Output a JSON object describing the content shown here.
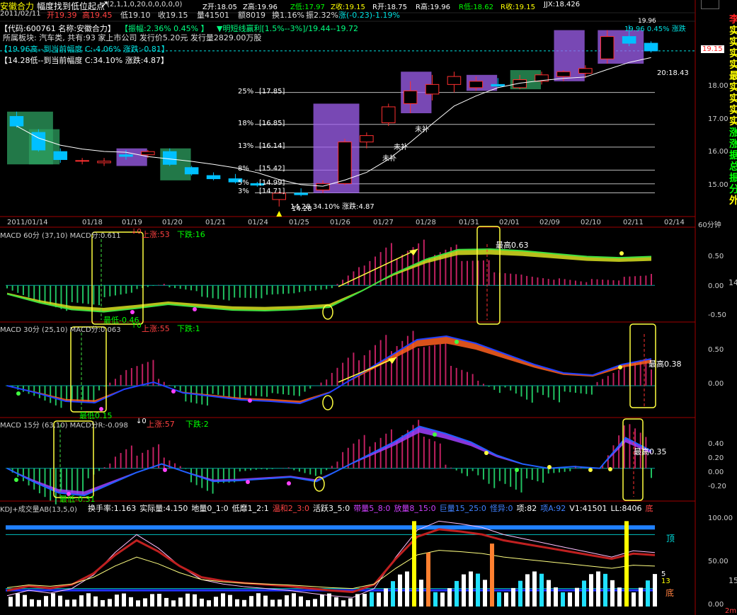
{
  "header": {
    "name": "安徽合力",
    "indicator": "幅度找到低位起点",
    "params": "(2,1,1,0,20,0,0,0,0,0)",
    "z_open": "Z开:18.05",
    "z_high": "Z高:19.96",
    "z_low": "Z低:17.97",
    "z_close": "Z收:19.15",
    "r_open": "R开:18.75",
    "r_high": "R高:19.96",
    "r_low": "R低:18.62",
    "r_close": "R收:19.15",
    "jjx": "JJX:18.426"
  },
  "quote_line": {
    "date": "2011/02/11",
    "open": "开19.39",
    "high": "高19.45",
    "low": "低19.10",
    "close": "收19.15",
    "volume": "量41501",
    "amount": "额8019",
    "turnover": "换1.16%",
    "amplitude": "振2.32%",
    "change": "涨(-0.23)-1.19%"
  },
  "info_lines": {
    "code_line": "【代码:600761 名称:安徽合力】",
    "amp_line": "【振幅:2.36% 0.45% 】",
    "profit_line": "▼明短线赢利[1.5%--3%]/19.44--19.72",
    "sector_line": "所属板块: 汽车类, 共有:93 家上市公司  发行价5.20元  发行量2829.00万股",
    "high_line": "【19.96高--到当前幅度 C:-4.06% 涨跌:-0.81】",
    "low_line": "【14.28低--到当前幅度 C:34.10% 涨跌:4.87】"
  },
  "main_chart": {
    "yticks": [
      "18.00",
      "17.00",
      "16.00",
      "15.00"
    ],
    "price_tag": "19.15",
    "ma_label": "20:18.43",
    "high_tag": "19.96",
    "low_tag": "14.28",
    "low_note": "14.28  34.10%  涨跌:4.87",
    "bu_labels": [
      "未补",
      "未补",
      "未补"
    ],
    "levels": [
      {
        "pct": "25%",
        "price": "[17.85]"
      },
      {
        "pct": "18%",
        "price": "[16.85]"
      },
      {
        "pct": "13%",
        "price": "[16.14]"
      },
      {
        "pct": "8%",
        "price": "[15.42]"
      },
      {
        "pct": "5%",
        "price": "[14.99]"
      },
      {
        "pct": "3%",
        "price": "[14.71]"
      }
    ],
    "top_right_note": "19.96  0.45%  涨跌"
  },
  "date_axis": {
    "dates": [
      "2011/01/14",
      "01/18",
      "01/19",
      "01/20",
      "01/21",
      "01/24",
      "01/25",
      "01/26",
      "01/27",
      "01/28",
      "01/31",
      "02/01",
      "02/09",
      "02/10",
      "02/11",
      "02/14"
    ],
    "period": "60分钟"
  },
  "macd60": {
    "title": "MACD 60分 (37,10)  MACD分:0.611",
    "up": "上涨:53",
    "down": "下跌:16",
    "yticks": [
      "0.50",
      "0.00",
      "-0.50"
    ],
    "low_note": "最低-0.46",
    "high_note": "最高0.63"
  },
  "macd30": {
    "title": "MACD 30分 (25,10)  MACD分:0.063",
    "up": "上涨:55",
    "down": "下跌:1",
    "yticks": [
      "0.50",
      "0.00"
    ],
    "low_note": "最低0.15",
    "high_note": "最高0.38"
  },
  "macd15": {
    "title": "MACD 15分 (63,10)  MACD分R:-0.098",
    "up": "上涨:57",
    "down": "下跌:2",
    "yticks": [
      "0.40",
      "0.20",
      "0.00",
      "-0.20"
    ],
    "low_note": "最低-0.31",
    "high_note": "最高0.35"
  },
  "kdj": {
    "title": "KDJ+成交量AB(13,5,0)",
    "items": [
      {
        "text": "换手率:1.163",
        "color": "#ffffff"
      },
      {
        "text": "实际量:4.150",
        "color": "#ffffff"
      },
      {
        "text": "地量0_1:0",
        "color": "#ffffff"
      },
      {
        "text": "低靡1_2:1",
        "color": "#ffffff"
      },
      {
        "text": "温和2_3:0",
        "color": "#ff4444"
      },
      {
        "text": "活跃3_5:0",
        "color": "#ffffff"
      },
      {
        "text": "带量5_8:0",
        "color": "#d040ff"
      },
      {
        "text": "放量8_15:0",
        "color": "#d040ff"
      },
      {
        "text": "巨量15_25:0",
        "color": "#4080ff"
      },
      {
        "text": "怪异:0",
        "color": "#4080ff"
      },
      {
        "text": "项:82",
        "color": "#ffffff"
      },
      {
        "text": "项A:92",
        "color": "#4080ff"
      },
      {
        "text": "V1:41501",
        "color": "#ffffff"
      },
      {
        "text": "LL:8406",
        "color": "#ffffff"
      },
      {
        "text": "底",
        "color": "#ff4444"
      }
    ],
    "yticks": [
      "100.00",
      "50.00",
      "0.00"
    ],
    "top_label": "顶",
    "bottom_label": "底",
    "num5": "5",
    "num13": "13"
  },
  "side_text": [
    "李",
    "实",
    "实",
    "实",
    "实",
    "最",
    "实",
    "实",
    "实",
    "实",
    "涨",
    "涨",
    "据",
    "总",
    "振",
    "分",
    "外"
  ],
  "side_right_ticks": [
    "14",
    "15"
  ],
  "bottom_label": "2m",
  "chart_data": {
    "type": "candlestick",
    "period": "60分钟",
    "title": "安徽合力",
    "ylim": [
      14.1,
      20.3
    ],
    "candles": [
      {
        "o": 17.1,
        "h": 17.25,
        "l": 16.75,
        "c": 16.8
      },
      {
        "o": 16.6,
        "h": 16.7,
        "l": 16.0,
        "c": 16.05
      },
      {
        "o": 16.0,
        "h": 16.1,
        "l": 15.65,
        "c": 15.75
      },
      {
        "o": 15.7,
        "h": 15.8,
        "l": 15.6,
        "c": 15.72
      },
      {
        "o": 15.65,
        "h": 15.8,
        "l": 15.55,
        "c": 15.7
      },
      {
        "o": 15.9,
        "h": 16.05,
        "l": 15.75,
        "c": 15.85
      },
      {
        "o": 15.9,
        "h": 16.05,
        "l": 15.8,
        "c": 16.0
      },
      {
        "o": 16.0,
        "h": 16.1,
        "l": 15.55,
        "c": 15.6
      },
      {
        "o": 15.5,
        "h": 15.55,
        "l": 15.25,
        "c": 15.3
      },
      {
        "o": 15.25,
        "h": 15.35,
        "l": 15.1,
        "c": 15.15
      },
      {
        "o": 15.15,
        "h": 15.3,
        "l": 15.0,
        "c": 15.05
      },
      {
        "o": 15.0,
        "h": 15.05,
        "l": 14.9,
        "c": 14.95
      },
      {
        "o": 14.5,
        "h": 14.75,
        "l": 14.28,
        "c": 14.7
      },
      {
        "o": 14.7,
        "h": 14.85,
        "l": 14.6,
        "c": 14.65
      },
      {
        "o": 14.8,
        "h": 15.1,
        "l": 14.7,
        "c": 15.0
      },
      {
        "o": 15.0,
        "h": 16.4,
        "l": 14.95,
        "c": 16.3
      },
      {
        "o": 16.3,
        "h": 16.6,
        "l": 16.1,
        "c": 16.5
      },
      {
        "o": 16.9,
        "h": 17.5,
        "l": 16.8,
        "c": 17.4
      },
      {
        "o": 17.5,
        "h": 18.2,
        "l": 17.2,
        "c": 17.9
      },
      {
        "o": 17.8,
        "h": 18.4,
        "l": 17.6,
        "c": 18.1
      },
      {
        "o": 18.1,
        "h": 18.5,
        "l": 17.85,
        "c": 18.35
      },
      {
        "o": 18.0,
        "h": 18.35,
        "l": 17.9,
        "c": 18.2
      },
      {
        "o": 18.1,
        "h": 18.3,
        "l": 18.0,
        "c": 18.05
      },
      {
        "o": 18.0,
        "h": 18.4,
        "l": 17.95,
        "c": 18.25
      },
      {
        "o": 18.2,
        "h": 18.5,
        "l": 18.1,
        "c": 18.4
      },
      {
        "o": 18.35,
        "h": 18.55,
        "l": 18.2,
        "c": 18.5
      },
      {
        "o": 18.45,
        "h": 18.7,
        "l": 18.3,
        "c": 18.6
      },
      {
        "o": 18.9,
        "h": 19.8,
        "l": 18.75,
        "c": 19.6
      },
      {
        "o": 19.6,
        "h": 19.96,
        "l": 19.3,
        "c": 19.39
      },
      {
        "o": 19.39,
        "h": 19.45,
        "l": 19.1,
        "c": 19.15
      }
    ],
    "ma20_label": "20:18.43",
    "levels_pct": [
      25,
      18,
      13,
      8,
      5,
      3
    ],
    "levels_price": [
      17.85,
      16.85,
      16.14,
      15.42,
      14.99,
      14.71
    ],
    "macd60": {
      "ylim": [
        -0.6,
        0.9
      ],
      "dif": [
        -0.15,
        -0.3,
        -0.42,
        -0.46,
        -0.4,
        -0.33,
        -0.38,
        -0.43,
        -0.44,
        -0.42,
        -0.38,
        -0.1,
        0.2,
        0.45,
        0.62,
        0.63,
        0.6,
        0.55,
        0.5,
        0.48,
        0.5
      ]
    },
    "macd30": {
      "ylim": [
        -0.4,
        0.8
      ],
      "dif": [
        0.0,
        -0.1,
        -0.22,
        -0.24,
        -0.05,
        0.05,
        -0.1,
        -0.15,
        -0.2,
        -0.22,
        -0.25,
        -0.1,
        0.15,
        0.4,
        0.65,
        0.7,
        0.6,
        0.45,
        0.3,
        0.18,
        0.15,
        0.3,
        0.38
      ]
    },
    "macd15": {
      "ylim": [
        -0.35,
        0.5
      ],
      "dif": [
        0.0,
        -0.15,
        -0.28,
        -0.31,
        -0.18,
        -0.05,
        0.05,
        -0.05,
        -0.15,
        -0.14,
        -0.12,
        -0.1,
        -0.15,
        0.0,
        0.15,
        0.3,
        0.48,
        0.4,
        0.3,
        0.15,
        0.05,
        0.0,
        0.02,
        0.0,
        0.35,
        0.2
      ]
    }
  }
}
